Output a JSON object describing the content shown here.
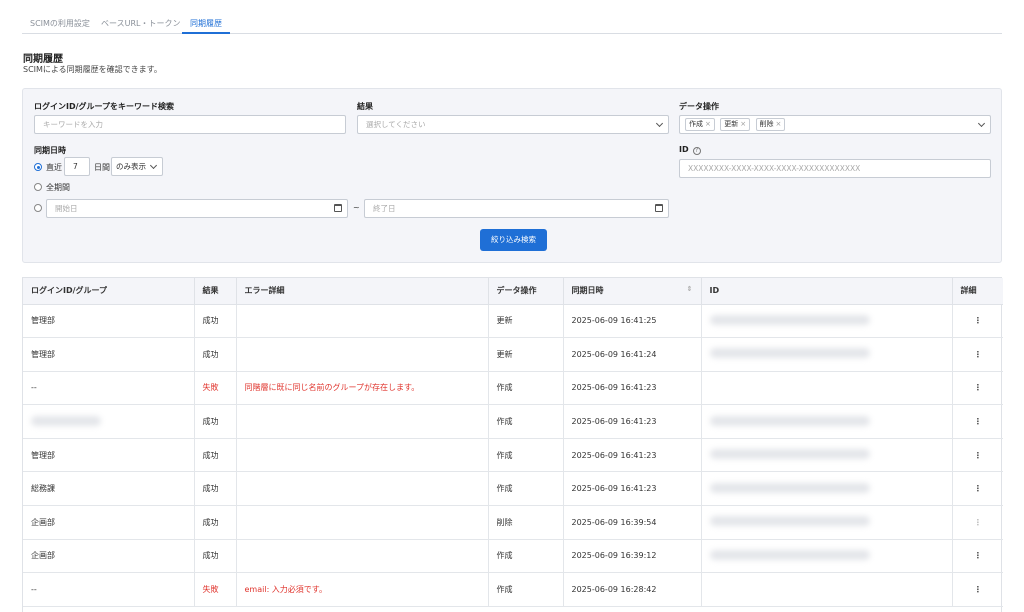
{
  "tabs": [
    {
      "label": "SCIMの利用設定",
      "active": false
    },
    {
      "label": "ベースURL・トークン",
      "active": false
    },
    {
      "label": "同期履歴",
      "active": true
    }
  ],
  "header": {
    "title": "同期履歴",
    "subtitle": "SCIMによる同期履歴を確認できます。"
  },
  "filter": {
    "keyword_label": "ログインID/グループをキーワード検索",
    "keyword_placeholder": "キーワードを入力",
    "result_label": "結果",
    "result_placeholder": "選択してください",
    "operation_label": "データ操作",
    "operation_chips": [
      "作成",
      "更新",
      "削除"
    ],
    "date_label": "同期日時",
    "recent_label": "直近",
    "recent_days": "7",
    "days_unit": "日間",
    "display_mode": "のみ表示",
    "all_period_label": "全期間",
    "start_placeholder": "開始日",
    "range_sep": "~",
    "end_placeholder": "終了日",
    "id_label": "ID",
    "id_placeholder": "XXXXXXXX-XXXX-XXXX-XXXX-XXXXXXXXXXXX",
    "search_button": "絞り込み検索"
  },
  "table": {
    "columns": [
      "ログインID/グループ",
      "結果",
      "エラー詳細",
      "データ操作",
      "同期日時",
      "ID",
      "詳細"
    ],
    "rows": [
      {
        "login": "管理部",
        "result": "成功",
        "error": "",
        "op": "更新",
        "datetime": "2025-06-09 16:41:25",
        "id_blurred": true,
        "fail": false
      },
      {
        "login": "管理部",
        "result": "成功",
        "error": "",
        "op": "更新",
        "datetime": "2025-06-09 16:41:24",
        "id_blurred": true,
        "fail": false
      },
      {
        "login": "--",
        "result": "失敗",
        "error": "同階層に既に同じ名前のグループが存在します。",
        "op": "作成",
        "datetime": "2025-06-09 16:41:23",
        "id_blurred": false,
        "fail": true
      },
      {
        "login": "",
        "result": "成功",
        "error": "",
        "op": "作成",
        "datetime": "2025-06-09 16:41:23",
        "id_blurred": true,
        "fail": false,
        "login_blurred": true
      },
      {
        "login": "管理部",
        "result": "成功",
        "error": "",
        "op": "作成",
        "datetime": "2025-06-09 16:41:23",
        "id_blurred": true,
        "fail": false
      },
      {
        "login": "総務課",
        "result": "成功",
        "error": "",
        "op": "作成",
        "datetime": "2025-06-09 16:41:23",
        "id_blurred": true,
        "fail": false
      },
      {
        "login": "企画部",
        "result": "成功",
        "error": "",
        "op": "削除",
        "datetime": "2025-06-09 16:39:54",
        "id_blurred": true,
        "fail": false,
        "kebab_dim": true
      },
      {
        "login": "企画部",
        "result": "成功",
        "error": "",
        "op": "作成",
        "datetime": "2025-06-09 16:39:12",
        "id_blurred": true,
        "fail": false
      },
      {
        "login": "--",
        "result": "失敗",
        "error": "email: 入力必須です。",
        "op": "作成",
        "datetime": "2025-06-09 16:28:42",
        "id_blurred": false,
        "fail": true
      }
    ]
  },
  "colors": {
    "accent": "#1f6fd6",
    "error": "#e0342d"
  }
}
